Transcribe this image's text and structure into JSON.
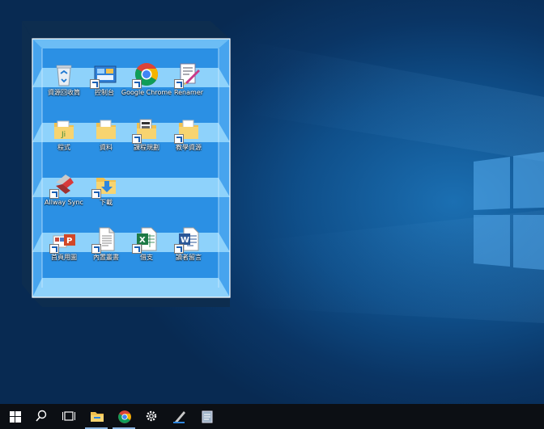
{
  "desktop": {
    "fence_icons": [
      {
        "label": "資源回收筒",
        "icon": "recycle-bin-icon",
        "shortcut": false
      },
      {
        "label": "控制台",
        "icon": "control-panel-icon",
        "shortcut": true
      },
      {
        "label": "Google Chrome",
        "icon": "chrome-icon",
        "shortcut": true
      },
      {
        "label": "Renamer",
        "icon": "renamer-icon",
        "shortcut": true
      },
      {
        "label": "程式",
        "icon": "folder-programs-icon",
        "shortcut": false
      },
      {
        "label": "資料",
        "icon": "folder-data-icon",
        "shortcut": false
      },
      {
        "label": "課程規劃",
        "icon": "folder-course-icon",
        "shortcut": true
      },
      {
        "label": "教學資源",
        "icon": "folder-teaching-icon",
        "shortcut": true
      },
      {
        "label": "Allway Sync",
        "icon": "allway-sync-icon",
        "shortcut": true
      },
      {
        "label": "下載",
        "icon": "downloads-folder-icon",
        "shortcut": true
      },
      {
        "label": "首頁用圖",
        "icon": "powerpoint-file-icon",
        "shortcut": true
      },
      {
        "label": "內置叢書",
        "icon": "text-file-icon",
        "shortcut": true
      },
      {
        "label": "借支",
        "icon": "excel-file-icon",
        "shortcut": true
      },
      {
        "label": "讀者留言",
        "icon": "word-file-icon",
        "shortcut": true
      }
    ]
  },
  "taskbar": {
    "items": [
      {
        "name": "start-icon"
      },
      {
        "name": "search-icon"
      },
      {
        "name": "task-view-icon"
      },
      {
        "name": "file-explorer-icon"
      },
      {
        "name": "chrome-icon"
      },
      {
        "name": "settings-gear-icon"
      },
      {
        "name": "pen-app-icon"
      },
      {
        "name": "notepad-app-icon"
      }
    ]
  },
  "colors": {
    "shelf": "#7cc7f7",
    "fence_back": "#2b90e4",
    "fence_edge": "#ffffff",
    "taskbar": "#0c0f14"
  }
}
